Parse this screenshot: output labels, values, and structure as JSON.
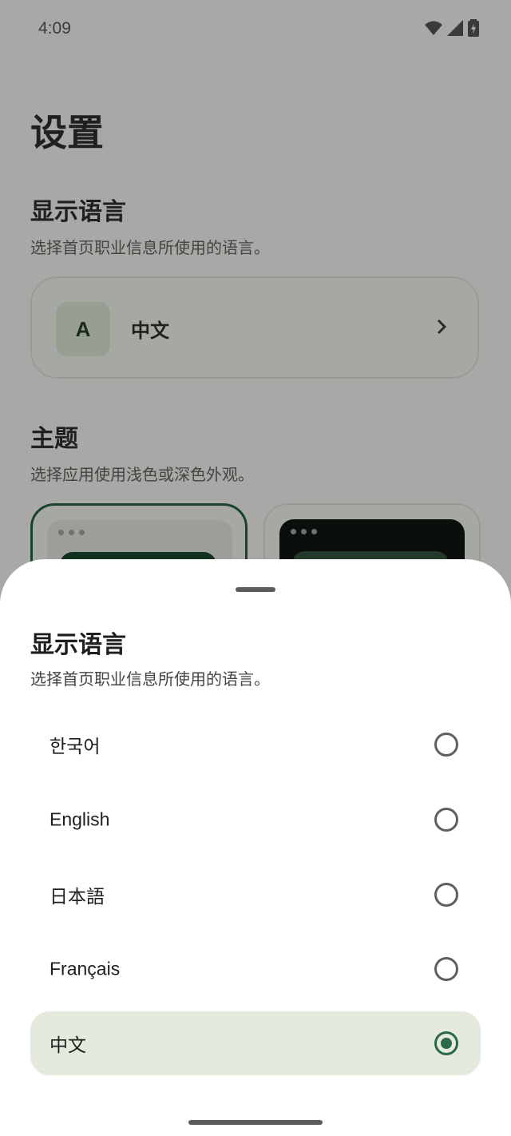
{
  "status_bar": {
    "time": "4:09",
    "icons": [
      "wifi-icon",
      "signal-icon",
      "battery-charging-icon"
    ]
  },
  "settings": {
    "title": "设置",
    "display_language": {
      "title": "显示语言",
      "description": "选择首页职业信息所使用的语言。",
      "current_icon_letter": "A",
      "current_value": "中文"
    },
    "theme": {
      "title": "主题",
      "description": "选择应用使用浅色或深色外观。",
      "options": [
        "light",
        "dark"
      ],
      "selected": "light"
    }
  },
  "sheet": {
    "title": "显示语言",
    "description": "选择首页职业信息所使用的语言。",
    "options": [
      {
        "label": "한국어",
        "selected": false
      },
      {
        "label": "English",
        "selected": false
      },
      {
        "label": "日本語",
        "selected": false
      },
      {
        "label": "Français",
        "selected": false
      },
      {
        "label": "中文",
        "selected": true
      }
    ]
  },
  "colors": {
    "accent": "#2b6a46",
    "selected_bg": "#e4eadd",
    "scrim": "#a9a8a6"
  }
}
